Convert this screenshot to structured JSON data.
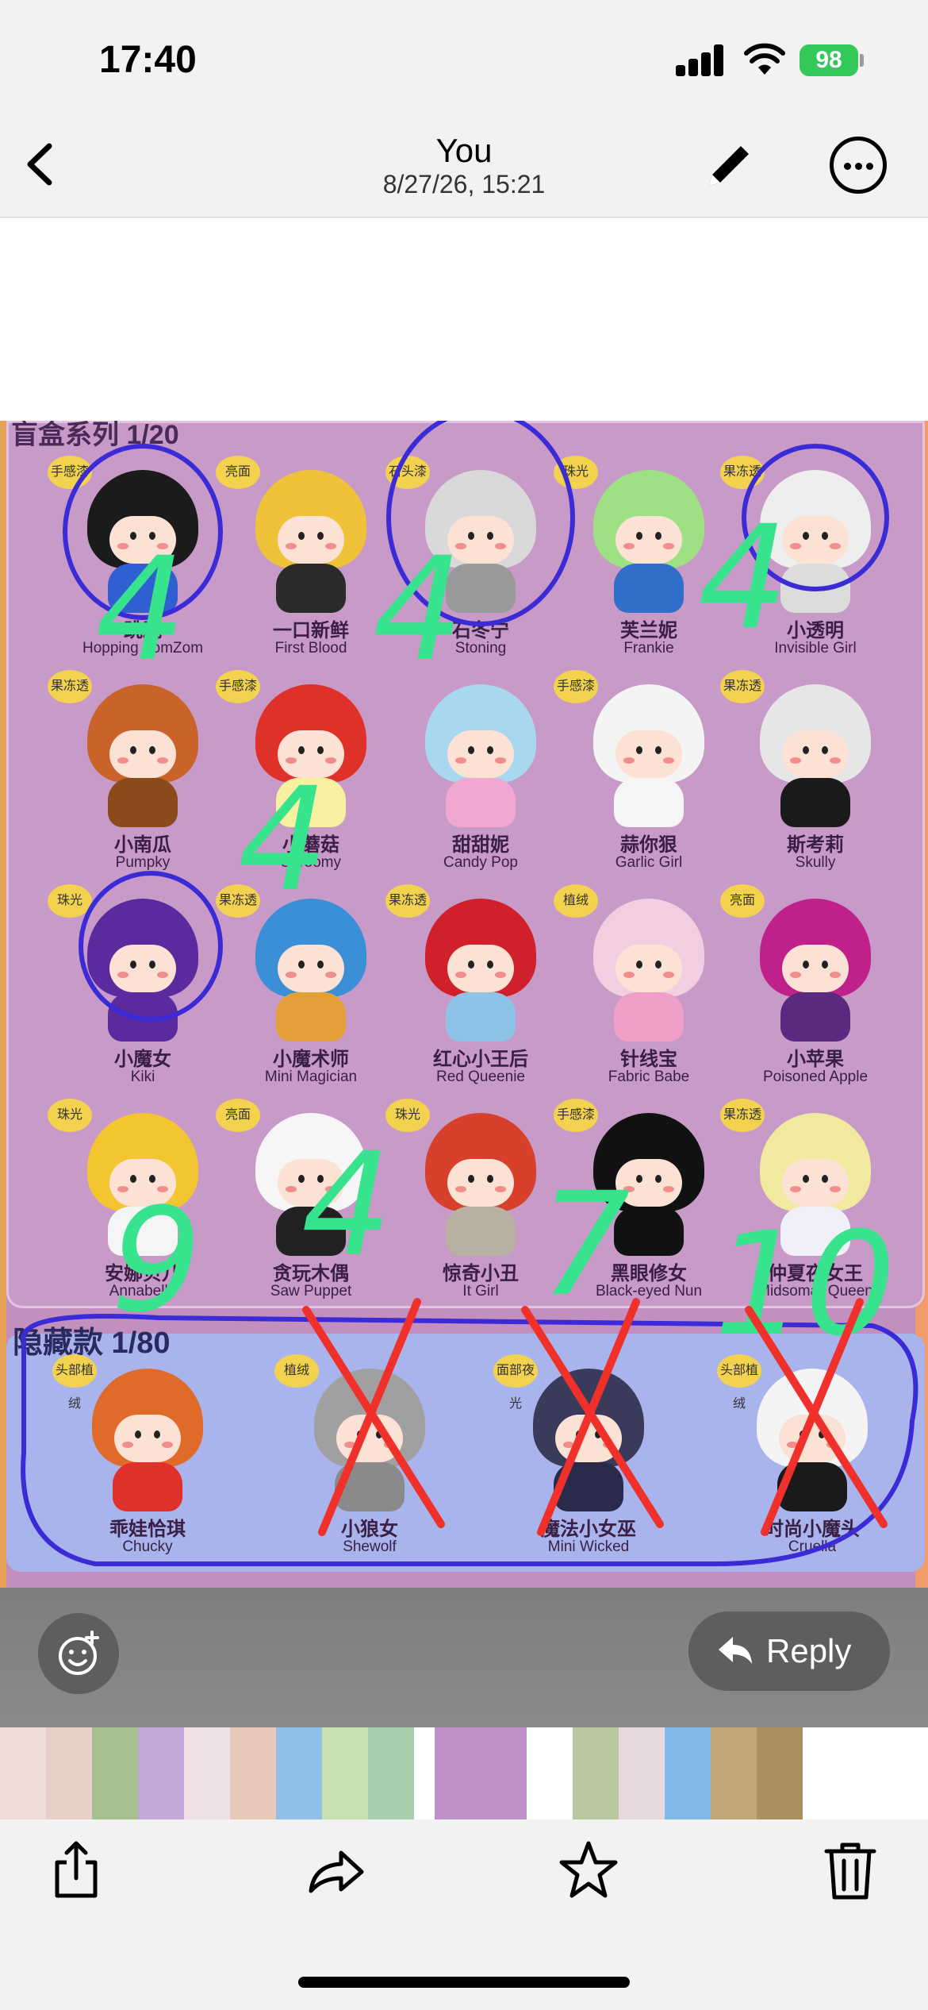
{
  "status_bar": {
    "time": "17:40",
    "battery": "98"
  },
  "nav": {
    "title": "You",
    "subtitle": "8/27/26, 15:21"
  },
  "photo": {
    "series_header": "盲盒系列 1/20",
    "secret_header": "隐藏款 1/80",
    "figures": [
      {
        "cn": "跳跳",
        "en": "Hopping ZomZom",
        "tag": "手感漆"
      },
      {
        "cn": "一口新鲜",
        "en": "First Blood",
        "tag": "亮面"
      },
      {
        "cn": "石冬宁",
        "en": "Stoning",
        "tag": "石头漆"
      },
      {
        "cn": "芙兰妮",
        "en": "Frankie",
        "tag": "珠光"
      },
      {
        "cn": "小透明",
        "en": "Invisible Girl",
        "tag": "果冻透"
      },
      {
        "cn": "小南瓜",
        "en": "Pumpky",
        "tag": "果冻透"
      },
      {
        "cn": "小蘑菇",
        "en": "Shroomy",
        "tag": "手感漆"
      },
      {
        "cn": "甜甜妮",
        "en": "Candy Pop",
        "tag": ""
      },
      {
        "cn": "蒜你狠",
        "en": "Garlic Girl",
        "tag": "手感漆"
      },
      {
        "cn": "斯考莉",
        "en": "Skully",
        "tag": "果冻透"
      },
      {
        "cn": "小魔女",
        "en": "Kiki",
        "tag": "珠光"
      },
      {
        "cn": "小魔术师",
        "en": "Mini Magician",
        "tag": "果冻透"
      },
      {
        "cn": "红心小王后",
        "en": "Red Queenie",
        "tag": "果冻透"
      },
      {
        "cn": "针线宝",
        "en": "Fabric Babe",
        "tag": "植绒"
      },
      {
        "cn": "小苹果",
        "en": "Poisoned Apple",
        "tag": "亮面"
      },
      {
        "cn": "安娜贝儿",
        "en": "Annabelle",
        "tag": "珠光"
      },
      {
        "cn": "贪玩木偶",
        "en": "Saw Puppet",
        "tag": "亮面"
      },
      {
        "cn": "惊奇小丑",
        "en": "It Girl",
        "tag": "珠光"
      },
      {
        "cn": "黑眼修女",
        "en": "Black-eyed Nun",
        "tag": "手感漆"
      },
      {
        "cn": "仲夏夜女王",
        "en": "Midsomar Queen",
        "tag": "果冻透"
      }
    ],
    "secret_figures": [
      {
        "cn": "乖娃恰琪",
        "en": "Chucky",
        "tag": "头部植绒"
      },
      {
        "cn": "小狼女",
        "en": "Shewolf",
        "tag": "植绒"
      },
      {
        "cn": "魔法小女巫",
        "en": "Mini Wicked",
        "tag": "面部夜光"
      },
      {
        "cn": "时尚小魔头",
        "en": "Cruella",
        "tag": "头部植绒"
      }
    ],
    "annotations": [
      "4",
      "4",
      "4",
      "4",
      "9",
      "4",
      "7",
      "10"
    ]
  },
  "reply_bar": {
    "reply_label": "Reply"
  },
  "colors": {
    "battery": "#34c759",
    "annotation_blue": "#3b2bd6",
    "annotation_green": "#37e38c",
    "annotation_red": "#f0302a"
  },
  "icons": [
    "back-chevron-icon",
    "pencil-icon",
    "more-icon",
    "tapback-icon",
    "reply-arrow-icon",
    "share-icon",
    "forward-icon",
    "star-icon",
    "trash-icon"
  ]
}
